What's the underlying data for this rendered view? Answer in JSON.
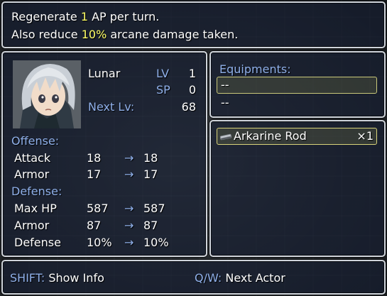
{
  "help": {
    "line1_pre": "Regenerate ",
    "line1_num": "1",
    "line1_post": " AP per turn.",
    "line2_pre": "Also reduce ",
    "line2_num": "10%",
    "line2_post": " arcane damage taken."
  },
  "actor": {
    "name": "Lunar",
    "lv_label": "LV",
    "lv": "1",
    "sp_label": "SP",
    "sp": "0",
    "next_label": "Next Lv:",
    "next": "68"
  },
  "offense": {
    "header": "Offense:",
    "rows": [
      {
        "label": "Attack",
        "from": "18",
        "to": "18"
      },
      {
        "label": "Armor",
        "from": "17",
        "to": "17"
      }
    ]
  },
  "defense": {
    "header": "Defense:",
    "rows": [
      {
        "label": "Max HP",
        "from": "587",
        "to": "587"
      },
      {
        "label": "Armor",
        "from": "87",
        "to": "87"
      },
      {
        "label": "Defense",
        "from": "10%",
        "to": "10%"
      }
    ]
  },
  "arrow_glyph": "→",
  "equipments": {
    "header": "Equipments:",
    "slots": [
      "--",
      "--"
    ]
  },
  "items": [
    {
      "name": "Arkarine Rod",
      "count": "×1",
      "icon": "rod-icon"
    }
  ],
  "footer": {
    "shift_key": "SHIFT:",
    "shift_action": " Show Info",
    "qw_key": "Q/W:",
    "qw_action": " Next Actor"
  },
  "colors": {
    "system": "#8fb0ea",
    "highlight": "#ffff66",
    "window_border": "#cfd4db"
  }
}
